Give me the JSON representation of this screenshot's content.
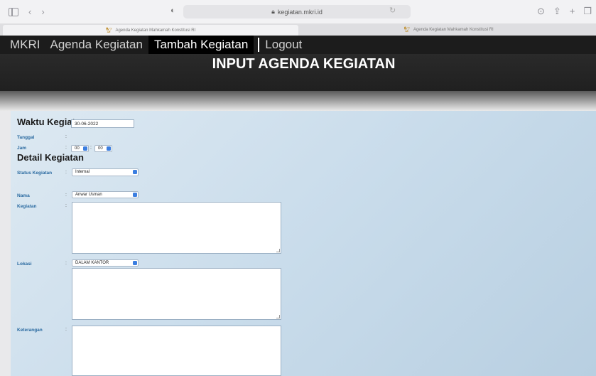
{
  "browser": {
    "url": "kegiatan.mkri.id",
    "tabs": [
      {
        "title": "Agenda Kegiatan Mahkamah Konstitusi RI"
      },
      {
        "title": "Agenda Kegiatan Mahkamah Konstitusi RI"
      }
    ]
  },
  "nav": {
    "brand": "MKRI",
    "items": [
      "Agenda Kegiatan",
      "Tambah Kegiatan",
      "Logout"
    ]
  },
  "banner": {
    "title": "INPUT AGENDA KEGIATAN"
  },
  "form": {
    "section_waktu": "Waktu Kegiatan",
    "section_detail": "Detail Kegiatan",
    "colon": ":",
    "tanggal": {
      "label": "Tanggal",
      "value": "30-06-2022"
    },
    "jam": {
      "label": "Jam",
      "hour": "00",
      "minute": "00"
    },
    "status": {
      "label": "Status Kegiatan",
      "value": "Internal"
    },
    "nama": {
      "label": "Nama",
      "value": "Anwar Usman"
    },
    "kegiatan": {
      "label": "Kegiatan",
      "value": ""
    },
    "lokasi": {
      "label": "Lokasi",
      "value": "DALAM KANTOR"
    },
    "keterangan": {
      "label": "Keterangan",
      "value": ""
    }
  }
}
